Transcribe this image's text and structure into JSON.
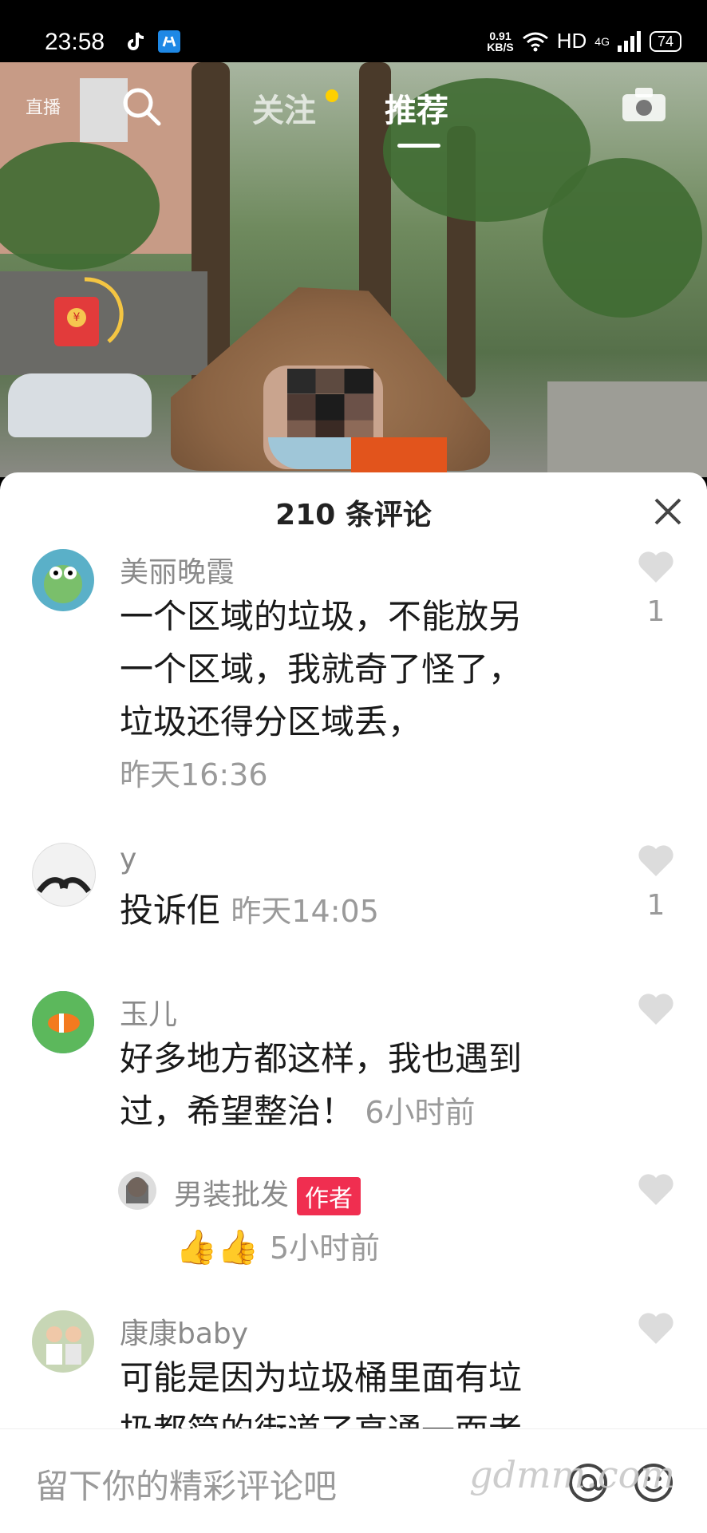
{
  "status_bar": {
    "time": "23:58",
    "net_speed_value": "0.91",
    "net_speed_unit": "KB/S",
    "hd": "HD",
    "network": "4G",
    "battery": "74"
  },
  "top_nav": {
    "live_label": "直播",
    "tabs": [
      {
        "label": "关注",
        "active": false,
        "has_dot": true
      },
      {
        "label": "推荐",
        "active": true
      }
    ],
    "icons": [
      "live-icon",
      "search-icon",
      "camera-icon"
    ]
  },
  "red_packet": {
    "symbol": "¥"
  },
  "comments_panel": {
    "header": "210 条评论",
    "comments": [
      {
        "username": "美丽晚霞",
        "lines": [
          "一个区域的垃圾，不能放另",
          "一个区域，我就奇了怪了，",
          "垃圾还得分区域丢，"
        ],
        "time": "昨天16:36",
        "likes": "1"
      },
      {
        "username": "y",
        "text": "投诉佢",
        "time": "昨天14:05",
        "likes": "1"
      },
      {
        "username": "玉儿",
        "lines": [
          "好多地方都这样，我也遇到",
          "过，希望整治！"
        ],
        "time": "6小时前",
        "likes": ""
      },
      {
        "username": "男装批发",
        "badge": "作者",
        "emoji": "👍👍",
        "time": "5小时前",
        "likes": ""
      },
      {
        "username": "康康baby",
        "lines": [
          "可能是因为垃圾桶里面有垃",
          "扔都简的街道了高通一面者"
        ],
        "likes": ""
      }
    ]
  },
  "input_bar": {
    "placeholder": "留下你的精彩评论吧",
    "watermark": "gdmm.com"
  },
  "colors": {
    "accent": "#f02e50",
    "panel_bg": "#ffffff",
    "status_bg": "#000000"
  }
}
